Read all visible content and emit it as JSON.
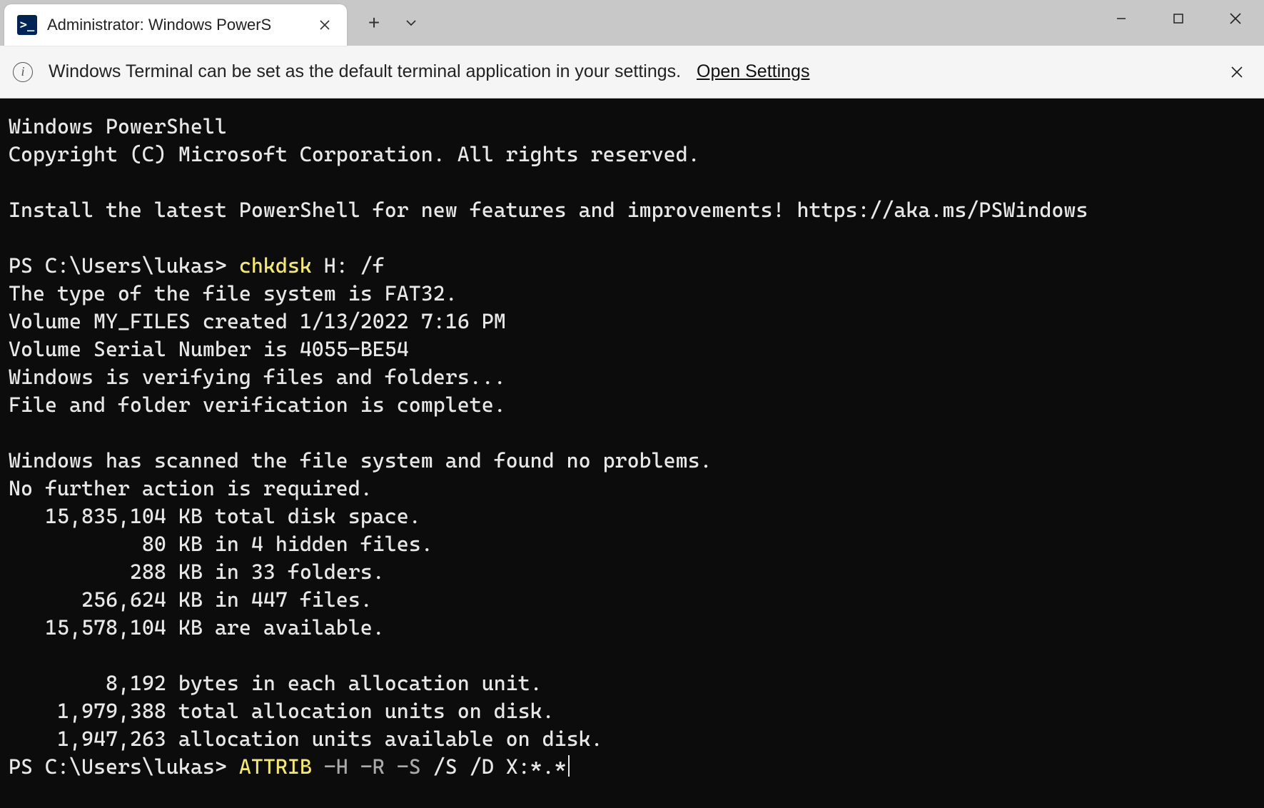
{
  "tab": {
    "title": "Administrator: Windows PowerS",
    "icon_glyph": ">_"
  },
  "titlebar": {
    "new_tab_glyph": "+",
    "dropdown_glyph": "⌄"
  },
  "infobar": {
    "message": "Windows Terminal can be set as the default terminal application in your settings.",
    "link_text": "Open Settings"
  },
  "terminal": {
    "header_line1": "Windows PowerShell",
    "header_line2": "Copyright (C) Microsoft Corporation. All rights reserved.",
    "install_msg": "Install the latest PowerShell for new features and improvements! https://aka.ms/PSWindows",
    "prompt1": "PS C:\\Users\\lukas> ",
    "cmd1": "chkdsk",
    "cmd1_args": " H: /f",
    "out_line1": "The type of the file system is FAT32.",
    "out_line2": "Volume MY_FILES created 1/13/2022 7:16 PM",
    "out_line3": "Volume Serial Number is 4055-BE54",
    "out_line4": "Windows is verifying files and folders...",
    "out_line5": "File and folder verification is complete.",
    "out_line6": "Windows has scanned the file system and found no problems.",
    "out_line7": "No further action is required.",
    "out_line8": "   15,835,104 KB total disk space.",
    "out_line9": "           80 KB in 4 hidden files.",
    "out_line10": "          288 KB in 33 folders.",
    "out_line11": "      256,624 KB in 447 files.",
    "out_line12": "   15,578,104 KB are available.",
    "out_line13": "        8,192 bytes in each allocation unit.",
    "out_line14": "    1,979,388 total allocation units on disk.",
    "out_line15": "    1,947,263 allocation units available on disk.",
    "prompt2": "PS C:\\Users\\lukas> ",
    "cmd2": "ATTRIB",
    "cmd2_flags": " -H -R -S",
    "cmd2_args": " /S /D X:*.*"
  }
}
